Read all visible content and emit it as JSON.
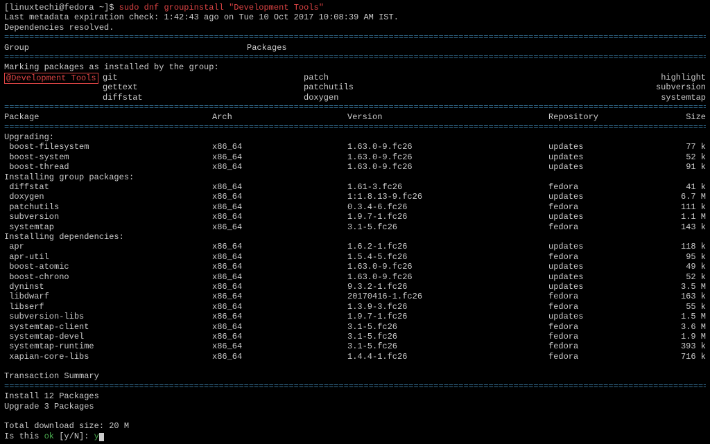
{
  "prompt": {
    "user_host": "[linuxtechi@fedora ~]$ ",
    "sudo": "sudo ",
    "cmd": "dnf groupinstall \"Development Tools\""
  },
  "meta1": "Last metadata expiration check: 1:42:43 ago on Tue 10 Oct 2017 10:08:39 AM IST.",
  "meta2": "Dependencies resolved.",
  "group_header": {
    "group": "Group",
    "packages": "Packages"
  },
  "marking": "Marking packages as installed by the group:",
  "group_name": "@Development Tools",
  "group_pkgs": {
    "col1": [
      "git",
      "gettext",
      "diffstat"
    ],
    "col2": [
      "patch",
      "patchutils",
      "doxygen"
    ],
    "col3": [
      "highlight",
      "subversion",
      "systemtap"
    ]
  },
  "pkg_header": {
    "name": "Package",
    "arch": "Arch",
    "ver": "Version",
    "repo": "Repository",
    "size": "Size"
  },
  "sections": [
    {
      "title": "Upgrading:",
      "rows": [
        {
          "name": "boost-filesystem",
          "arch": "x86_64",
          "ver": "1.63.0-9.fc26",
          "repo": "updates",
          "size": "77 k"
        },
        {
          "name": "boost-system",
          "arch": "x86_64",
          "ver": "1.63.0-9.fc26",
          "repo": "updates",
          "size": "52 k"
        },
        {
          "name": "boost-thread",
          "arch": "x86_64",
          "ver": "1.63.0-9.fc26",
          "repo": "updates",
          "size": "91 k"
        }
      ]
    },
    {
      "title": "Installing group packages:",
      "rows": [
        {
          "name": "diffstat",
          "arch": "x86_64",
          "ver": "1.61-3.fc26",
          "repo": "fedora",
          "size": "41 k"
        },
        {
          "name": "doxygen",
          "arch": "x86_64",
          "ver": "1:1.8.13-9.fc26",
          "repo": "updates",
          "size": "6.7 M"
        },
        {
          "name": "patchutils",
          "arch": "x86_64",
          "ver": "0.3.4-6.fc26",
          "repo": "fedora",
          "size": "111 k"
        },
        {
          "name": "subversion",
          "arch": "x86_64",
          "ver": "1.9.7-1.fc26",
          "repo": "updates",
          "size": "1.1 M"
        },
        {
          "name": "systemtap",
          "arch": "x86_64",
          "ver": "3.1-5.fc26",
          "repo": "fedora",
          "size": "143 k"
        }
      ]
    },
    {
      "title": "Installing dependencies:",
      "rows": [
        {
          "name": "apr",
          "arch": "x86_64",
          "ver": "1.6.2-1.fc26",
          "repo": "updates",
          "size": "118 k"
        },
        {
          "name": "apr-util",
          "arch": "x86_64",
          "ver": "1.5.4-5.fc26",
          "repo": "fedora",
          "size": "95 k"
        },
        {
          "name": "boost-atomic",
          "arch": "x86_64",
          "ver": "1.63.0-9.fc26",
          "repo": "updates",
          "size": "49 k"
        },
        {
          "name": "boost-chrono",
          "arch": "x86_64",
          "ver": "1.63.0-9.fc26",
          "repo": "updates",
          "size": "52 k"
        },
        {
          "name": "dyninst",
          "arch": "x86_64",
          "ver": "9.3.2-1.fc26",
          "repo": "updates",
          "size": "3.5 M"
        },
        {
          "name": "libdwarf",
          "arch": "x86_64",
          "ver": "20170416-1.fc26",
          "repo": "fedora",
          "size": "163 k"
        },
        {
          "name": "libserf",
          "arch": "x86_64",
          "ver": "1.3.9-3.fc26",
          "repo": "fedora",
          "size": "55 k"
        },
        {
          "name": "subversion-libs",
          "arch": "x86_64",
          "ver": "1.9.7-1.fc26",
          "repo": "updates",
          "size": "1.5 M"
        },
        {
          "name": "systemtap-client",
          "arch": "x86_64",
          "ver": "3.1-5.fc26",
          "repo": "fedora",
          "size": "3.6 M"
        },
        {
          "name": "systemtap-devel",
          "arch": "x86_64",
          "ver": "3.1-5.fc26",
          "repo": "fedora",
          "size": "1.9 M"
        },
        {
          "name": "systemtap-runtime",
          "arch": "x86_64",
          "ver": "3.1-5.fc26",
          "repo": "fedora",
          "size": "393 k"
        },
        {
          "name": "xapian-core-libs",
          "arch": "x86_64",
          "ver": "1.4.4-1.fc26",
          "repo": "fedora",
          "size": "716 k"
        }
      ]
    }
  ],
  "txn": "Transaction Summary",
  "summary": {
    "install": "Install  12 Packages",
    "upgrade": "Upgrade   3 Packages"
  },
  "dl": "Total download size: 20 M",
  "confirm": {
    "pre": "Is this ",
    "ok": "ok",
    "post": " [y/N]: ",
    "ans": "y"
  },
  "sep": "================================================================================================================================================="
}
